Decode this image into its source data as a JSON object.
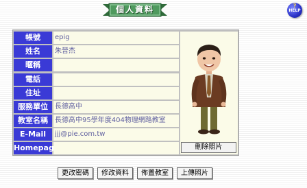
{
  "header": {
    "title": "個人資料",
    "help_label": "HELP",
    "help_icon": "help-question-icon"
  },
  "profile": {
    "fields": [
      {
        "label": "帳號",
        "value": "epig"
      },
      {
        "label": "姓名",
        "value": "朱晉杰"
      },
      {
        "label": "暱稱",
        "value": ""
      },
      {
        "label": "電話",
        "value": ""
      },
      {
        "label": "住址",
        "value": ""
      },
      {
        "label": "服務單位",
        "value": "長德高中"
      },
      {
        "label": "教室名稱",
        "value": "長德高中95學年度404物理網路教室"
      },
      {
        "label": "E-Mail",
        "value": "jjj@pie.com.tw"
      },
      {
        "label": "Homepage",
        "value": ""
      }
    ],
    "delete_photo_label": "刪除照片"
  },
  "actions": {
    "change_password": "更改密碼",
    "edit_profile": "修改資料",
    "arrange_classroom": "佈置教室",
    "upload_photo": "上傳照片"
  }
}
